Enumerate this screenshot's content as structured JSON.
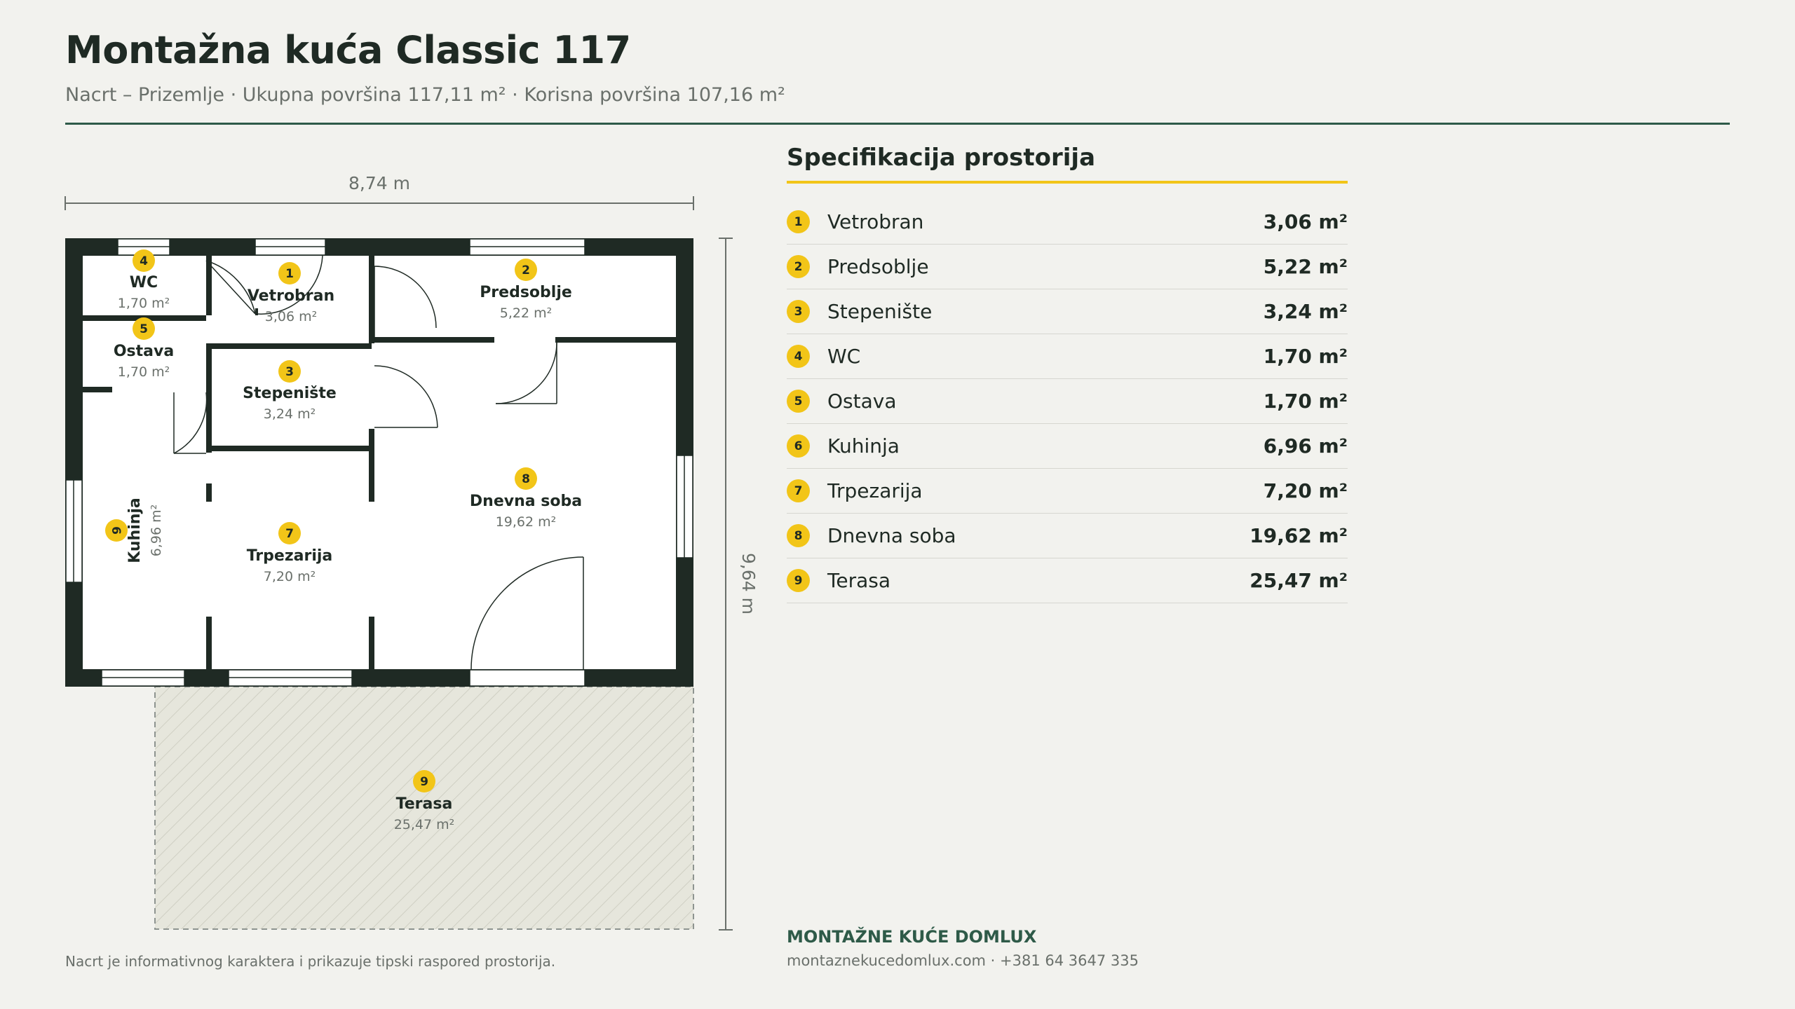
{
  "title": "Montažna kuća Classic 117",
  "subtitle": "Nacrt – Prizemlje · Ukupna površina 117,11 m² · Korisna površina 107,16 m²",
  "plan": {
    "width_label": "8,74 m",
    "height_label": "9,64 m",
    "footnote": "Nacrt je informativnog karaktera i prikazuje tipski raspored prostorija."
  },
  "rooms": [
    {
      "num": "1",
      "name": "Vetrobran",
      "area": "3,06 m²"
    },
    {
      "num": "2",
      "name": "Predsoblje",
      "area": "5,22 m²"
    },
    {
      "num": "3",
      "name": "Stepenište",
      "area": "3,24 m²"
    },
    {
      "num": "4",
      "name": "WC",
      "area": "1,70 m²"
    },
    {
      "num": "5",
      "name": "Ostava",
      "area": "1,70 m²"
    },
    {
      "num": "6",
      "name": "Kuhinja",
      "area": "6,96 m²"
    },
    {
      "num": "7",
      "name": "Trpezarija",
      "area": "7,20 m²"
    },
    {
      "num": "8",
      "name": "Dnevna soba",
      "area": "19,62 m²"
    },
    {
      "num": "9",
      "name": "Terasa",
      "area": "25,47 m²"
    }
  ],
  "spec": {
    "title": "Specifikacija prostorija"
  },
  "brand": {
    "name": "MONTAŽNE KUĆE DOMLUX",
    "contact": "montaznekucedomlux.com · +381 64 3647 335"
  },
  "colors": {
    "wall": "#1f2a24",
    "accent": "#f2c518",
    "brand": "#2e5a48",
    "terrace": "#e6e6dc"
  }
}
